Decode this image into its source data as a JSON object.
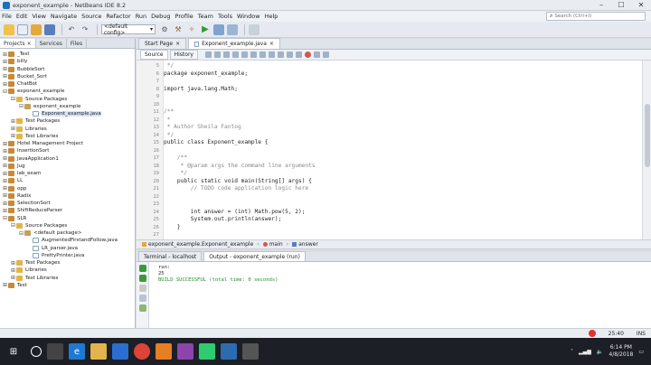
{
  "window": {
    "title": "exponent_example - NetBeans IDE 8.2"
  },
  "menu": [
    "File",
    "Edit",
    "View",
    "Navigate",
    "Source",
    "Refactor",
    "Run",
    "Debug",
    "Profile",
    "Team",
    "Tools",
    "Window",
    "Help"
  ],
  "search": {
    "placeholder": "Search (Ctrl+I)"
  },
  "toolbar": {
    "config": "<default config>"
  },
  "left_tabs": [
    "Projects",
    "Services",
    "Files"
  ],
  "tree": [
    {
      "label": "_Test",
      "depth": 0,
      "icon": "project",
      "tog": "+"
    },
    {
      "label": "billy",
      "depth": 0,
      "icon": "project",
      "tog": "+"
    },
    {
      "label": "BubbleSort",
      "depth": 0,
      "icon": "project",
      "tog": "+"
    },
    {
      "label": "Bucket_Sort",
      "depth": 0,
      "icon": "project",
      "tog": "+"
    },
    {
      "label": "ChatBot",
      "depth": 0,
      "icon": "project",
      "tog": "+"
    },
    {
      "label": "exponent_example",
      "depth": 0,
      "icon": "project",
      "tog": "−"
    },
    {
      "label": "Source Packages",
      "depth": 1,
      "icon": "folder",
      "tog": "−"
    },
    {
      "label": "exponent_example",
      "depth": 2,
      "icon": "package",
      "tog": "−"
    },
    {
      "label": "Exponent_example.java",
      "depth": 3,
      "icon": "java",
      "tog": "",
      "selected": true
    },
    {
      "label": "Test Packages",
      "depth": 1,
      "icon": "folder",
      "tog": "+"
    },
    {
      "label": "Libraries",
      "depth": 1,
      "icon": "folder",
      "tog": "+"
    },
    {
      "label": "Test Libraries",
      "depth": 1,
      "icon": "folder",
      "tog": "+"
    },
    {
      "label": "Hotel Management Project",
      "depth": 0,
      "icon": "project",
      "tog": "+"
    },
    {
      "label": "InsertionSort",
      "depth": 0,
      "icon": "project",
      "tog": "+"
    },
    {
      "label": "JavaApplication1",
      "depth": 0,
      "icon": "project",
      "tog": "+"
    },
    {
      "label": "Jug",
      "depth": 0,
      "icon": "project",
      "tog": "+"
    },
    {
      "label": "lab_exam",
      "depth": 0,
      "icon": "project",
      "tog": "+"
    },
    {
      "label": "LL",
      "depth": 0,
      "icon": "project",
      "tog": "+"
    },
    {
      "label": "opp",
      "depth": 0,
      "icon": "project",
      "tog": "+"
    },
    {
      "label": "Radix",
      "depth": 0,
      "icon": "project",
      "tog": "+"
    },
    {
      "label": "SelectionSort",
      "depth": 0,
      "icon": "project",
      "tog": "+"
    },
    {
      "label": "ShiftReduceParser",
      "depth": 0,
      "icon": "project",
      "tog": "+"
    },
    {
      "label": "SLR",
      "depth": 0,
      "icon": "project",
      "tog": "−"
    },
    {
      "label": "Source Packages",
      "depth": 1,
      "icon": "folder",
      "tog": "−"
    },
    {
      "label": "<default package>",
      "depth": 2,
      "icon": "package",
      "tog": "−"
    },
    {
      "label": "AugmentedFirstandFollow.java",
      "depth": 3,
      "icon": "java",
      "tog": ""
    },
    {
      "label": "LR_parser.java",
      "depth": 3,
      "icon": "java",
      "tog": ""
    },
    {
      "label": "PrettyPrinter.java",
      "depth": 3,
      "icon": "java",
      "tog": ""
    },
    {
      "label": "Test Packages",
      "depth": 1,
      "icon": "folder",
      "tog": "+"
    },
    {
      "label": "Libraries",
      "depth": 1,
      "icon": "folder",
      "tog": "+"
    },
    {
      "label": "Test Libraries",
      "depth": 1,
      "icon": "folder",
      "tog": "+"
    },
    {
      "label": "Test",
      "depth": 0,
      "icon": "project",
      "tog": "+"
    }
  ],
  "editor_tabs": [
    {
      "label": "Start Page",
      "active": false
    },
    {
      "label": "Exponent_example.java",
      "active": true
    }
  ],
  "source_tabs": [
    "Source",
    "History"
  ],
  "code_lines": [
    {
      "n": "5",
      "text": " */",
      "type": "cm"
    },
    {
      "n": "6",
      "text": "package exponent_example;",
      "type": "plain"
    },
    {
      "n": "7",
      "text": "",
      "type": "plain"
    },
    {
      "n": "8",
      "text": "import java.lang.Math;",
      "type": "plain"
    },
    {
      "n": "9",
      "text": "",
      "type": "plain"
    },
    {
      "n": "10",
      "text": "",
      "type": "plain"
    },
    {
      "n": "11",
      "text": "/**",
      "type": "cm"
    },
    {
      "n": "12",
      "text": " *",
      "type": "cm"
    },
    {
      "n": "13",
      "text": " * Author Sheila Fantog",
      "type": "cm"
    },
    {
      "n": "14",
      "text": " */",
      "type": "cm"
    },
    {
      "n": "15",
      "text": "public class Exponent_example {",
      "type": "plain"
    },
    {
      "n": "16",
      "text": "",
      "type": "plain"
    },
    {
      "n": "17",
      "text": "    /**",
      "type": "cm"
    },
    {
      "n": "18",
      "text": "     * @param args the command line arguments",
      "type": "cm"
    },
    {
      "n": "19",
      "text": "     */",
      "type": "cm"
    },
    {
      "n": "20",
      "text": "    public static void main(String[] args) {",
      "type": "plain"
    },
    {
      "n": "21",
      "text": "        // TODO code application logic here",
      "type": "cm"
    },
    {
      "n": "22",
      "text": "",
      "type": "plain"
    },
    {
      "n": "23",
      "text": "",
      "type": "plain"
    },
    {
      "n": "24",
      "text": "        int answer = (int) Math.pow(5, 2);",
      "type": "plain"
    },
    {
      "n": "25",
      "text": "        System.out.println(answer);",
      "type": "plain"
    },
    {
      "n": "26",
      "text": "    }",
      "type": "plain"
    },
    {
      "n": "27",
      "text": "",
      "type": "plain"
    }
  ],
  "breadcrumb": [
    "exponent_example.Exponent_example",
    "main",
    "answer"
  ],
  "output_tabs": [
    {
      "label": "Terminal - localhost",
      "active": false
    },
    {
      "label": "Output - exponent_example (run)",
      "active": true
    }
  ],
  "output_lines": [
    {
      "text": "run:",
      "green": false
    },
    {
      "text": "25",
      "green": false
    },
    {
      "text": "BUILD SUCCESSFUL (total time: 0 seconds)",
      "green": true
    }
  ],
  "status": {
    "position": "25:40",
    "mode": "INS"
  },
  "taskbar": {
    "time": "6:14 PM",
    "date": "4/8/2018"
  }
}
